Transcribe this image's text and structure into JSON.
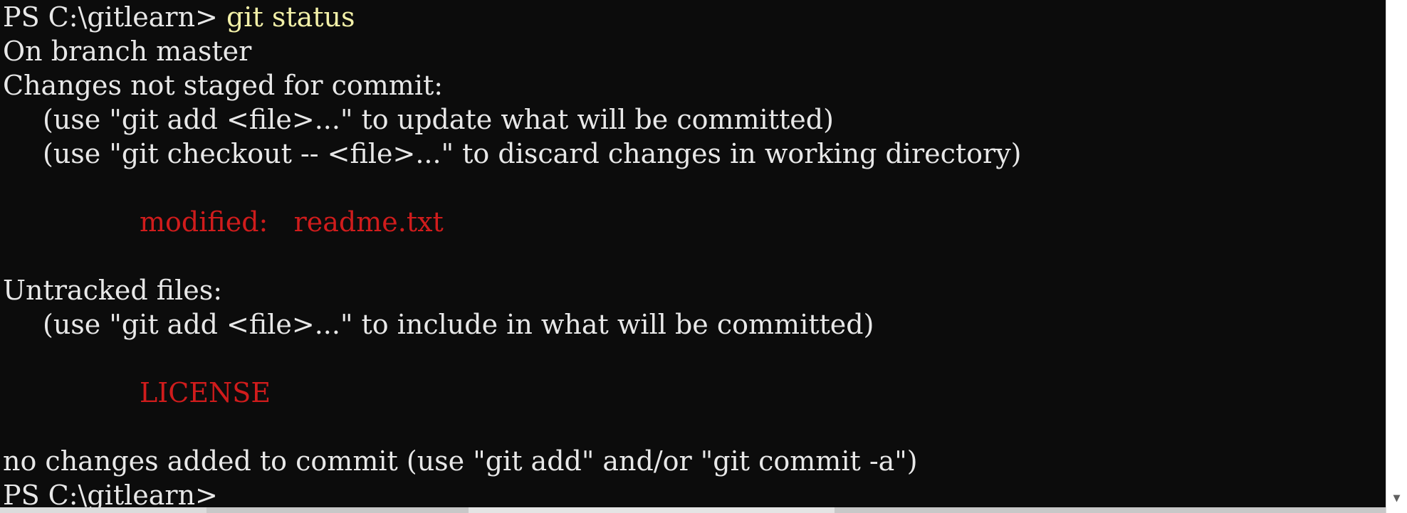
{
  "terminal": {
    "prompt": "PS C:\\gitlearn>",
    "command": "git status",
    "lines": {
      "branch": "On branch master",
      "changes_header": "Changes not staged for commit:",
      "hint_add": "(use \"git add <file>...\" to update what will be committed)",
      "hint_checkout": "(use \"git checkout -- <file>...\" to discard changes in working directory)",
      "modified_label": "modified:",
      "modified_file": "readme.txt",
      "untracked_header": "Untracked files:",
      "hint_untracked": "(use \"git add <file>...\" to include in what will be committed)",
      "untracked_file": "LICENSE",
      "summary": "no changes added to commit (use \"git add\" and/or \"git commit -a\")"
    },
    "final_prompt": "PS C:\\gitlearn>"
  },
  "scrollbar": {
    "down_arrow": "▼"
  },
  "colors": {
    "background": "#0c0c0c",
    "text": "#e8e8e8",
    "command": "#f2f0a8",
    "git_red": "#d01c1c"
  }
}
